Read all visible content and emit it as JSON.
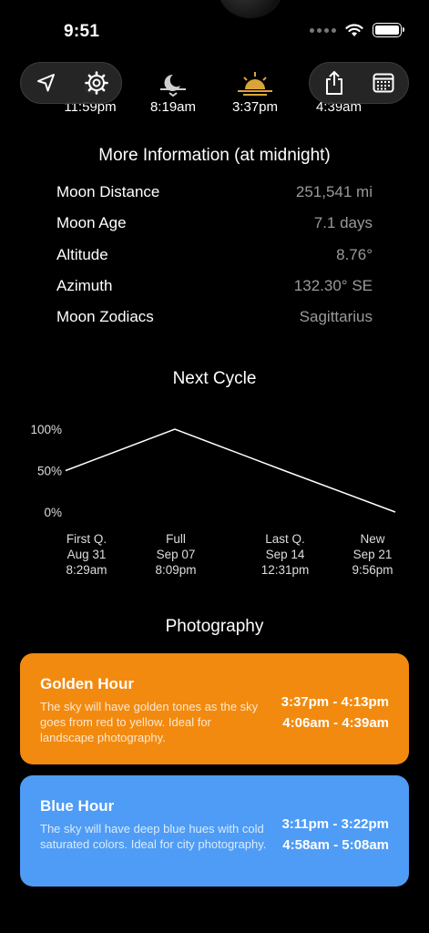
{
  "status": {
    "time": "9:51"
  },
  "times": [
    {
      "icon": "moonrise-icon",
      "value": "11:59pm"
    },
    {
      "icon": "moonset-icon",
      "value": "8:19am"
    },
    {
      "icon": "sunset-icon",
      "value": "3:37pm"
    },
    {
      "icon": "sunrise-icon",
      "value": "4:39am"
    }
  ],
  "toolbar": {
    "left": [
      "location-arrow-icon",
      "gear-icon"
    ],
    "right": [
      "share-icon",
      "calendar-icon"
    ]
  },
  "more_info": {
    "title": "More Information (at midnight)",
    "rows": [
      {
        "label": "Moon Distance",
        "value": "251,541 mi"
      },
      {
        "label": "Moon Age",
        "value": "7.1 days"
      },
      {
        "label": "Altitude",
        "value": "8.76°"
      },
      {
        "label": "Azimuth",
        "value": "132.30° SE"
      },
      {
        "label": "Moon Zodiacs",
        "value": "Sagittarius"
      }
    ]
  },
  "next_cycle": {
    "title": "Next Cycle",
    "phases": [
      {
        "name": "First Q.",
        "date": "Aug 31",
        "time": "8:29am"
      },
      {
        "name": "Full",
        "date": "Sep 07",
        "time": "8:09pm"
      },
      {
        "name": "Last Q.",
        "date": "Sep 14",
        "time": "12:31pm"
      },
      {
        "name": "New",
        "date": "Sep 21",
        "time": "9:56pm"
      }
    ]
  },
  "chart_data": {
    "type": "line",
    "x": [
      "Aug 31",
      "Sep 07",
      "Sep 14",
      "Sep 21"
    ],
    "values": [
      50,
      100,
      50,
      0
    ],
    "yticks": [
      "100%",
      "50%",
      "0%"
    ],
    "ylim": [
      0,
      100
    ],
    "grid": false
  },
  "photography": {
    "title": "Photography",
    "golden": {
      "title": "Golden Hour",
      "desc": "The sky will have golden tones as the sky goes from red to yellow. Ideal for landscape photography.",
      "times": [
        "3:37pm - 4:13pm",
        "4:06am - 4:39am"
      ],
      "color": "#F28A0F"
    },
    "blue": {
      "title": "Blue Hour",
      "desc": "The sky will have deep blue hues with cold saturated colors. Ideal for city photography.",
      "times": [
        "3:11pm - 3:22pm",
        "4:58am - 5:08am"
      ],
      "color": "#4E9CF5"
    }
  }
}
